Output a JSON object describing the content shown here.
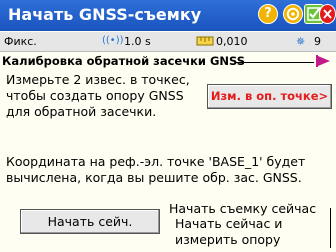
{
  "app": {
    "title": "Начать GNSS-съемку",
    "title_icons": {
      "help": "?",
      "settings": "gear",
      "ok": "check",
      "close": "close"
    }
  },
  "status": {
    "mode": "Фикс.",
    "interval": "1.0 s",
    "precision": "0,010",
    "satellites": "9"
  },
  "section": {
    "title": "Калибровка обратной засечки GNSS"
  },
  "main": {
    "instruction_lines": [
      "Измерьте 2 извес. в точкес,",
      "чтобы создать опору GNSS",
      "для обратной засечки."
    ],
    "measure_button": "Изм. в оп. точке>",
    "info_lines": [
      "Координата на реф.-эл. точке 'BASE_1' будет",
      "вычислена, когда вы решите обр. зас. GNSS."
    ]
  },
  "start_group": {
    "title": "Начать съемку сейчас",
    "start_button": "Начать сейч.",
    "desc_lines": [
      "Начать сейчас и",
      "измерить опору"
    ]
  },
  "colors": {
    "titlebar": "#1e5bc8",
    "statusbar": "#e6e6e6",
    "background": "#fffef2",
    "accent_red": "#e31b1b",
    "section_arrow": "#c21a8a"
  }
}
